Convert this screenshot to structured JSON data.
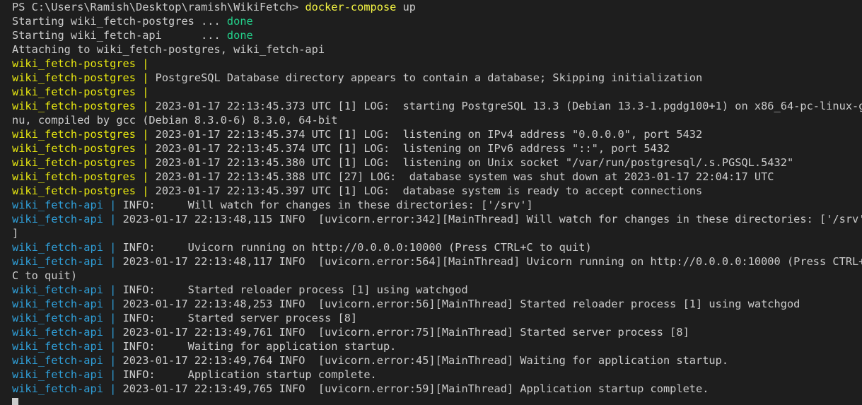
{
  "colors": {
    "background": "#1e1e1e",
    "text": "#cccccc",
    "postgres_prefix": "#e5e510",
    "api_prefix": "#2f9fd9",
    "done": "#23d18b",
    "command": "#f5f543"
  },
  "prompt": {
    "path": "PS C:\\Users\\Ramish\\Desktop\\ramish\\WikiFetch> ",
    "command": "docker-compose",
    "argument": " up"
  },
  "startup": [
    {
      "text": "Starting wiki_fetch-postgres ... ",
      "status": "done"
    },
    {
      "text": "Starting wiki_fetch-api      ... ",
      "status": "done"
    }
  ],
  "attaching": "Attaching to wiki_fetch-postgres, wiki_fetch-api",
  "lines": [
    {
      "prefix": "wiki_fetch-postgres |",
      "service": "postgres",
      "text": ""
    },
    {
      "prefix": "wiki_fetch-postgres |",
      "service": "postgres",
      "text": " PostgreSQL Database directory appears to contain a database; Skipping initialization"
    },
    {
      "prefix": "wiki_fetch-postgres |",
      "service": "postgres",
      "text": ""
    },
    {
      "prefix": "wiki_fetch-postgres |",
      "service": "postgres",
      "text": " 2023-01-17 22:13:45.373 UTC [1] LOG:  starting PostgreSQL 13.3 (Debian 13.3-1.pgdg100+1) on x86_64-pc-linux-g"
    },
    {
      "prefix": "",
      "service": "none",
      "text": "nu, compiled by gcc (Debian 8.3.0-6) 8.3.0, 64-bit"
    },
    {
      "prefix": "wiki_fetch-postgres |",
      "service": "postgres",
      "text": " 2023-01-17 22:13:45.374 UTC [1] LOG:  listening on IPv4 address \"0.0.0.0\", port 5432"
    },
    {
      "prefix": "wiki_fetch-postgres |",
      "service": "postgres",
      "text": " 2023-01-17 22:13:45.374 UTC [1] LOG:  listening on IPv6 address \"::\", port 5432"
    },
    {
      "prefix": "wiki_fetch-postgres |",
      "service": "postgres",
      "text": " 2023-01-17 22:13:45.380 UTC [1] LOG:  listening on Unix socket \"/var/run/postgresql/.s.PGSQL.5432\""
    },
    {
      "prefix": "wiki_fetch-postgres |",
      "service": "postgres",
      "text": " 2023-01-17 22:13:45.388 UTC [27] LOG:  database system was shut down at 2023-01-17 22:04:17 UTC"
    },
    {
      "prefix": "wiki_fetch-postgres |",
      "service": "postgres",
      "text": " 2023-01-17 22:13:45.397 UTC [1] LOG:  database system is ready to accept connections"
    },
    {
      "prefix": "wiki_fetch-api |",
      "service": "api",
      "text": " INFO:     Will watch for changes in these directories: ['/srv']"
    },
    {
      "prefix": "wiki_fetch-api |",
      "service": "api",
      "text": " 2023-01-17 22:13:48,115 INFO  [uvicorn.error:342][MainThread] Will watch for changes in these directories: ['/srv'"
    },
    {
      "prefix": "",
      "service": "none",
      "text": "]"
    },
    {
      "prefix": "wiki_fetch-api |",
      "service": "api",
      "text": " INFO:     Uvicorn running on http://0.0.0.0:10000 (Press CTRL+C to quit)"
    },
    {
      "prefix": "wiki_fetch-api |",
      "service": "api",
      "text": " 2023-01-17 22:13:48,117 INFO  [uvicorn.error:564][MainThread] Uvicorn running on http://0.0.0.0:10000 (Press CTRL+"
    },
    {
      "prefix": "",
      "service": "none",
      "text": "C to quit)"
    },
    {
      "prefix": "wiki_fetch-api |",
      "service": "api",
      "text": " INFO:     Started reloader process [1] using watchgod"
    },
    {
      "prefix": "wiki_fetch-api |",
      "service": "api",
      "text": " 2023-01-17 22:13:48,253 INFO  [uvicorn.error:56][MainThread] Started reloader process [1] using watchgod"
    },
    {
      "prefix": "wiki_fetch-api |",
      "service": "api",
      "text": " INFO:     Started server process [8]"
    },
    {
      "prefix": "wiki_fetch-api |",
      "service": "api",
      "text": " 2023-01-17 22:13:49,761 INFO  [uvicorn.error:75][MainThread] Started server process [8]"
    },
    {
      "prefix": "wiki_fetch-api |",
      "service": "api",
      "text": " INFO:     Waiting for application startup."
    },
    {
      "prefix": "wiki_fetch-api |",
      "service": "api",
      "text": " 2023-01-17 22:13:49,764 INFO  [uvicorn.error:45][MainThread] Waiting for application startup."
    },
    {
      "prefix": "wiki_fetch-api |",
      "service": "api",
      "text": " INFO:     Application startup complete."
    },
    {
      "prefix": "wiki_fetch-api |",
      "service": "api",
      "text": " 2023-01-17 22:13:49,765 INFO  [uvicorn.error:59][MainThread] Application startup complete."
    }
  ]
}
